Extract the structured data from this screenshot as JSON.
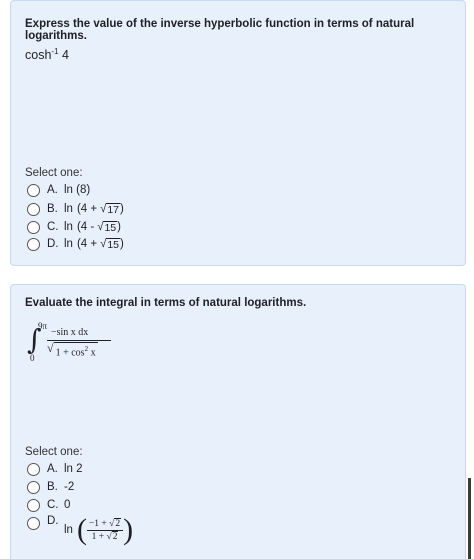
{
  "q1": {
    "text": "Express the value of the inverse hyperbolic function in terms of natural logarithms.",
    "expr_fn": "cosh",
    "expr_sup": "-1",
    "expr_arg": "4",
    "select_label": "Select one:",
    "options": [
      {
        "letter": "A.",
        "text": "ln (8)"
      },
      {
        "letter": "B.",
        "ln": "ln",
        "pre": "(4 + ",
        "rad": "17",
        "post": ")"
      },
      {
        "letter": "C.",
        "ln": "ln",
        "pre": "(4 - ",
        "rad": "15",
        "post": ")"
      },
      {
        "letter": "D.",
        "ln": "ln",
        "pre": "(4 + ",
        "rad": "15",
        "post": ")"
      }
    ]
  },
  "q2": {
    "text": "Evaluate the integral in terms of natural logarithms.",
    "integral": {
      "upper": "9π",
      "lower": "0",
      "numerator": "−sin x dx",
      "den_pre": "1 + cos",
      "den_exp": "2",
      "den_post": " x"
    },
    "select_label": "Select one:",
    "options": [
      {
        "letter": "A.",
        "text": "ln 2"
      },
      {
        "letter": "B.",
        "text": "-2"
      },
      {
        "letter": "C.",
        "text": "0"
      },
      {
        "letter": "D.",
        "ln": "ln",
        "num_pre": "−1 + ",
        "num_rad": "2",
        "den_pre": "1 + ",
        "den_rad": "2"
      }
    ]
  }
}
